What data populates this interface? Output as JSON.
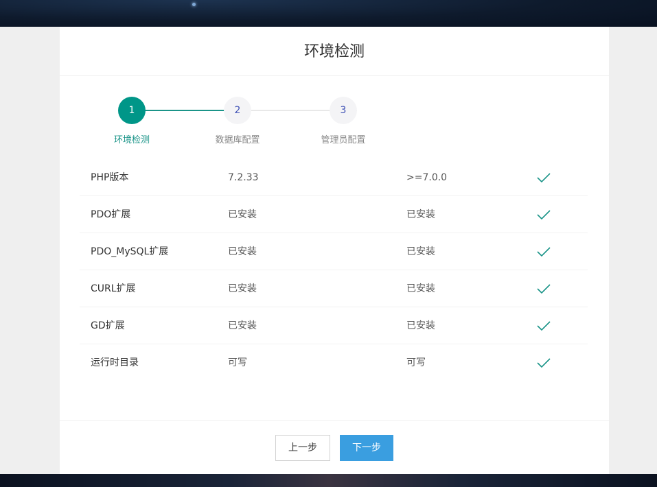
{
  "page": {
    "title": "环境检测"
  },
  "steps": [
    {
      "number": "1",
      "label": "环境检测",
      "state": "active"
    },
    {
      "number": "2",
      "label": "数据库配置",
      "state": "pending"
    },
    {
      "number": "3",
      "label": "管理员配置",
      "state": "pending"
    }
  ],
  "checks": [
    {
      "name": "PHP版本",
      "current": "7.2.33",
      "required": ">=7.0.0",
      "passed": true
    },
    {
      "name": "PDO扩展",
      "current": "已安装",
      "required": "已安装",
      "passed": true
    },
    {
      "name": "PDO_MySQL扩展",
      "current": "已安装",
      "required": "已安装",
      "passed": true
    },
    {
      "name": "CURL扩展",
      "current": "已安装",
      "required": "已安装",
      "passed": true
    },
    {
      "name": "GD扩展",
      "current": "已安装",
      "required": "已安装",
      "passed": true
    },
    {
      "name": "运行时目录",
      "current": "可写",
      "required": "可写",
      "passed": true
    }
  ],
  "footer": {
    "prev_label": "上一步",
    "next_label": "下一步"
  },
  "colors": {
    "accent": "#009688",
    "primary_button": "#3a9ee0",
    "check": "#1a9488"
  },
  "icons": {
    "passed": "check-icon"
  }
}
